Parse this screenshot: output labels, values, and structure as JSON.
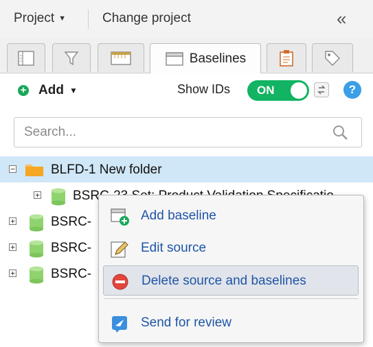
{
  "header": {
    "project_label": "Project",
    "change_project_label": "Change project"
  },
  "tabs": [
    {
      "icon": "document-list-icon",
      "label": ""
    },
    {
      "icon": "filter-icon",
      "label": ""
    },
    {
      "icon": "ruler-grid-icon",
      "label": ""
    },
    {
      "icon": "window-icon",
      "label": "Baselines",
      "active": true
    },
    {
      "icon": "clipboard-icon",
      "label": ""
    },
    {
      "icon": "tag-icon",
      "label": ""
    }
  ],
  "toolbar": {
    "add_label": "Add",
    "show_ids_label": "Show IDs",
    "toggle_label": "ON",
    "toggle_state": "on",
    "help_label": "?"
  },
  "search": {
    "placeholder": "Search..."
  },
  "tree": {
    "nodes": [
      {
        "label": "BLFD-1 New folder",
        "type": "folder",
        "selected": true,
        "expanded": true
      },
      {
        "label": "BSRC-23 Set: Product Validation Specificatio",
        "type": "source"
      },
      {
        "label": "BSRC-",
        "type": "source"
      },
      {
        "label": "BSRC-",
        "type": "source"
      },
      {
        "label": "BSRC-",
        "type": "source"
      }
    ]
  },
  "context_menu": {
    "items": [
      {
        "label": "Add baseline",
        "icon": "add-baseline-icon"
      },
      {
        "label": "Edit source",
        "icon": "pencil-edit-icon"
      },
      {
        "label": "Delete source and baselines",
        "icon": "delete-circle-icon",
        "hovered": true
      },
      {
        "label": "Send for review",
        "icon": "send-review-icon"
      }
    ]
  },
  "colors": {
    "toggle_on": "#12b362",
    "selection": "#cfe7f6",
    "menu_text": "#1f55a6",
    "folder": "#f5a623",
    "database": "#8fd36f"
  }
}
